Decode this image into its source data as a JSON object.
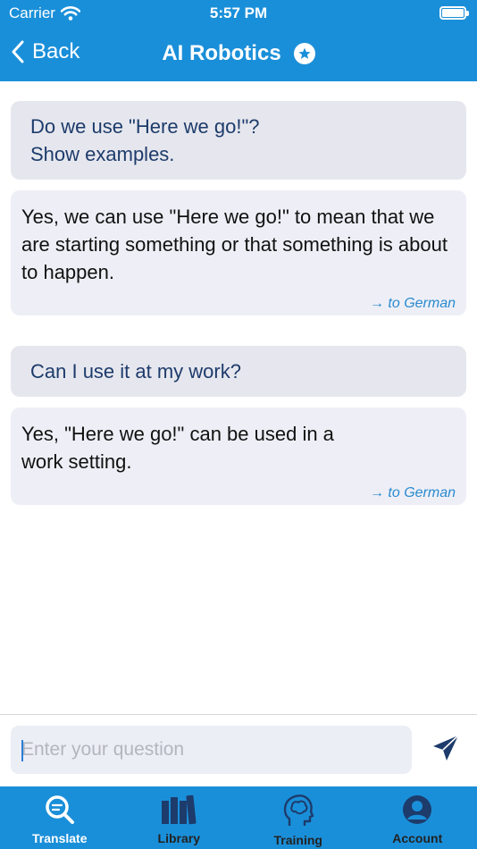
{
  "status_bar": {
    "carrier": "Carrier",
    "time": "5:57 PM"
  },
  "nav": {
    "back_label": "Back",
    "title": "AI Robotics"
  },
  "messages": [
    {
      "role": "question",
      "text": "Do we use \"Here we go!\"? Show examples."
    },
    {
      "role": "answer",
      "text": "Yes, we can use \"Here we go!\" to mean that we are starting something or that something is about to happen.",
      "translate_link": "→ to German"
    },
    {
      "role": "question",
      "text": "Can I use it at my work?"
    },
    {
      "role": "answer",
      "text": "Yes, \"Here we go!\" can be used in a work setting.",
      "translate_link": "→ to German"
    }
  ],
  "input": {
    "placeholder": "Enter your question",
    "value": ""
  },
  "tabs": [
    {
      "label": "Translate",
      "icon": "search-translate-icon",
      "active": true
    },
    {
      "label": "Library",
      "icon": "books-icon",
      "active": false
    },
    {
      "label": "Training",
      "icon": "brain-head-icon",
      "active": false
    },
    {
      "label": "Account",
      "icon": "user-circle-icon",
      "active": false
    }
  ],
  "colors": {
    "accent": "#1a8fd9",
    "question_bg": "#e6e7ee",
    "answer_bg": "#eeeff6",
    "question_text": "#1d3b6b",
    "link": "#2a8ad0",
    "send": "#1d3b6b"
  }
}
